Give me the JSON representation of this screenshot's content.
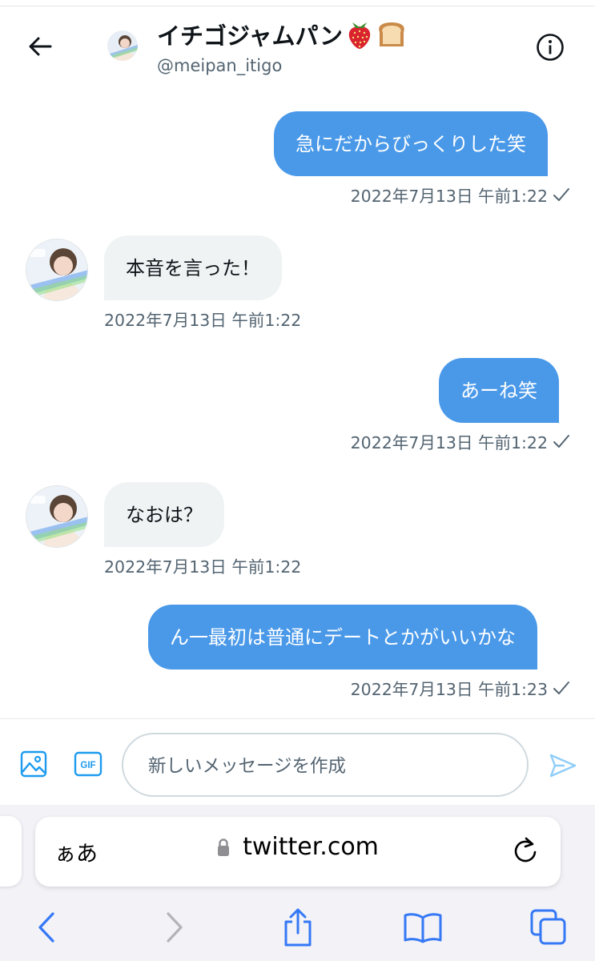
{
  "header": {
    "name": "イチゴジャムパン",
    "name_emoji": [
      "strawberry",
      "bread"
    ],
    "handle": "@meipan_itigo"
  },
  "messages": [
    {
      "direction": "sent",
      "text": "急にだからびっくりした笑",
      "time": "2022年7月13日 午前1:22",
      "status": "read-check-icon"
    },
    {
      "direction": "received",
      "text": "本音を言った！",
      "time": "2022年7月13日 午前1:22"
    },
    {
      "direction": "sent",
      "text": "あーね笑",
      "time": "2022年7月13日 午前1:22",
      "status": "read-check-icon"
    },
    {
      "direction": "received",
      "text": "なおは？",
      "time": "2022年7月13日 午前1:22"
    },
    {
      "direction": "sent",
      "text": "ん一最初は普通にデートとかがいいかな",
      "time": "2022年7月13日 午前1:23",
      "status": "read-check-icon"
    }
  ],
  "composer": {
    "placeholder": "新しいメッセージを作成",
    "gif_label": "GIF"
  },
  "browser": {
    "aa_label": "ぁあ",
    "url": "twitter.com"
  },
  "colors": {
    "accent": "#1d9bf0",
    "sent_bubble": "#4a99e9",
    "received_bubble": "#eff3f4",
    "safari_blue": "#3478f6"
  }
}
